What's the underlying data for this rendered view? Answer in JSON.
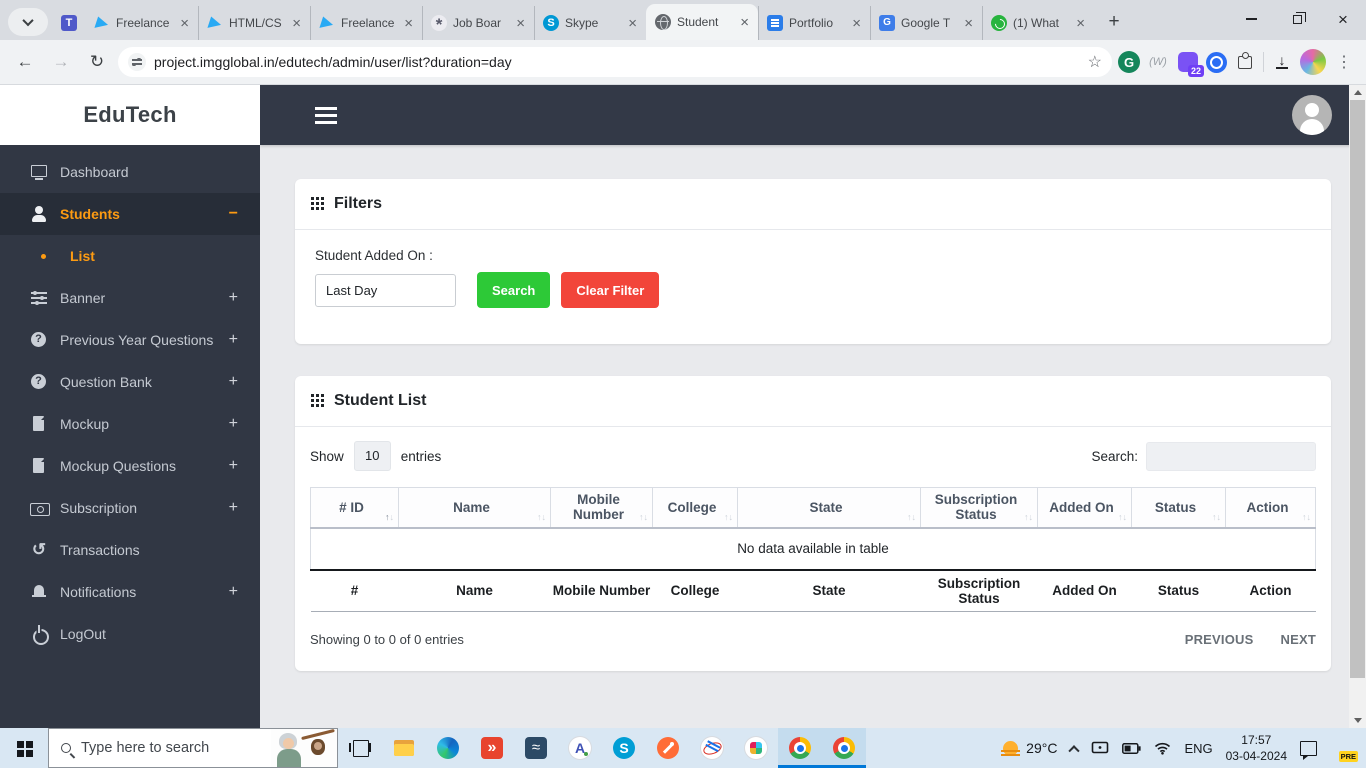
{
  "icons": {
    "back": "←",
    "forward": "→",
    "reload": "↻",
    "star": "☆",
    "dots": "⋮",
    "close": "×",
    "new_tab": "+",
    "arrow_up": "↑",
    "arrow_down": "↓",
    "download": "↓"
  },
  "browser": {
    "url": "project.imgglobal.in/edutech/admin/user/list?duration=day",
    "extension_badge": "22",
    "tabs": [
      {
        "title": "Freelance",
        "icon_name": "freelancer-icon",
        "iconcls": "ic-freelancer",
        "state": ""
      },
      {
        "title": "HTML/CS",
        "icon_name": "freelancer-icon",
        "iconcls": "ic-freelancer",
        "state": ""
      },
      {
        "title": "Freelance",
        "icon_name": "freelancer-icon",
        "iconcls": "ic-freelancer",
        "state": ""
      },
      {
        "title": "Job Boar",
        "icon_name": "chatgpt-icon",
        "iconcls": "ic-chatgpt",
        "state": ""
      },
      {
        "title": "Skype",
        "icon_name": "skype-icon",
        "iconcls": "ic-skype",
        "state": ""
      },
      {
        "title": "Student",
        "icon_name": "globe-icon",
        "iconcls": "ic-globe",
        "state": "active"
      },
      {
        "title": "Portfolio",
        "icon_name": "docs-icon",
        "iconcls": "ic-docs",
        "state": ""
      },
      {
        "title": "Google T",
        "icon_name": "translate-icon",
        "iconcls": "ic-translate",
        "state": ""
      },
      {
        "title": "(1) What",
        "icon_name": "whatsapp-icon",
        "iconcls": "ic-whatsapp",
        "state": ""
      }
    ]
  },
  "sidebar": {
    "brand": "EduTech",
    "items": [
      {
        "label": "Dashboard",
        "icon_name": "monitor-icon",
        "iconcls": "si-monitor",
        "suffix": "",
        "cls": ""
      },
      {
        "label": "Students",
        "icon_name": "user-icon",
        "iconcls": "si-user",
        "suffix": "−",
        "cls": "active"
      },
      {
        "label": "List",
        "icon_name": "bullet-icon",
        "iconcls": "si-bullet",
        "suffix": "",
        "cls": "sub"
      },
      {
        "label": "Banner",
        "icon_name": "sliders-icon",
        "iconcls": "si-sliders",
        "suffix": "+",
        "cls": ""
      },
      {
        "label": "Previous Year Questions",
        "icon_name": "question-icon",
        "iconcls": "si-question",
        "suffix": "+",
        "cls": ""
      },
      {
        "label": "Question Bank",
        "icon_name": "question-icon",
        "iconcls": "si-question",
        "suffix": "+",
        "cls": ""
      },
      {
        "label": "Mockup",
        "icon_name": "file-icon",
        "iconcls": "si-file",
        "suffix": "+",
        "cls": ""
      },
      {
        "label": "Mockup Questions",
        "icon_name": "file-icon",
        "iconcls": "si-file",
        "suffix": "+",
        "cls": ""
      },
      {
        "label": "Subscription",
        "icon_name": "banknote-icon",
        "iconcls": "si-money",
        "suffix": "+",
        "cls": ""
      },
      {
        "label": "Transactions",
        "icon_name": "history-icon",
        "iconcls": "si-history",
        "suffix": "",
        "cls": ""
      },
      {
        "label": "Notifications",
        "icon_name": "bell-icon",
        "iconcls": "si-bell",
        "suffix": "+",
        "cls": ""
      },
      {
        "label": "LogOut",
        "icon_name": "power-icon",
        "iconcls": "si-power",
        "suffix": "",
        "cls": ""
      }
    ]
  },
  "filters": {
    "title": "Filters",
    "label": "Student Added On :",
    "value": "Last Day",
    "search_btn": "Search",
    "clear_btn": "Clear Filter"
  },
  "list": {
    "title": "Student List",
    "show_label": "Show",
    "page_len": "10",
    "entries_label": "entries",
    "search_label": "Search:",
    "columns": [
      {
        "label": "# ID",
        "sortcls": "sorted-asc"
      },
      {
        "label": "Name",
        "sortcls": ""
      },
      {
        "label": "Mobile Number",
        "sortcls": ""
      },
      {
        "label": "College",
        "sortcls": ""
      },
      {
        "label": "State",
        "sortcls": ""
      },
      {
        "label": "Subscription Status",
        "sortcls": ""
      },
      {
        "label": "Added On",
        "sortcls": ""
      },
      {
        "label": "Status",
        "sortcls": ""
      },
      {
        "label": "Action",
        "sortcls": ""
      }
    ],
    "footer": [
      "#",
      "Name",
      "Mobile Number",
      "College",
      "State",
      "Subscription Status",
      "Added On",
      "Status",
      "Action"
    ],
    "empty": "No data available in table",
    "info": "Showing 0 to 0 of 0 entries",
    "prev": "PREVIOUS",
    "next": "NEXT"
  },
  "taskbar": {
    "search_placeholder": "Type here to search",
    "weather_temp": "29°C",
    "language": "ENG",
    "time": "17:57",
    "date": "03-04-2024",
    "copilot_badge": "PRE",
    "apps": [
      {
        "icon_name": "task-view-icon",
        "iconcls": "app-taskview",
        "state": ""
      },
      {
        "icon_name": "file-explorer-icon",
        "iconcls": "app-folder",
        "state": ""
      },
      {
        "icon_name": "edge-icon",
        "iconcls": "app-edge",
        "state": ""
      },
      {
        "icon_name": "red-code-app-icon",
        "iconcls": "app-red",
        "state": ""
      },
      {
        "icon_name": "pgadmin-icon",
        "iconcls": "app-pg",
        "state": ""
      },
      {
        "icon_name": "compass-app-icon",
        "iconcls": "app-compass",
        "state": ""
      },
      {
        "icon_name": "skype-icon",
        "iconcls": "app-skype",
        "state": ""
      },
      {
        "icon_name": "postman-icon",
        "iconcls": "app-postman",
        "state": ""
      },
      {
        "icon_name": "snipping-tool-icon",
        "iconcls": "app-snip",
        "state": ""
      },
      {
        "icon_name": "slack-icon",
        "iconcls": "app-slack",
        "state": ""
      },
      {
        "icon_name": "chrome-icon",
        "iconcls": "app-chrome",
        "state": "active"
      },
      {
        "icon_name": "chrome-icon",
        "iconcls": "app-chrome",
        "state": "active"
      }
    ]
  }
}
